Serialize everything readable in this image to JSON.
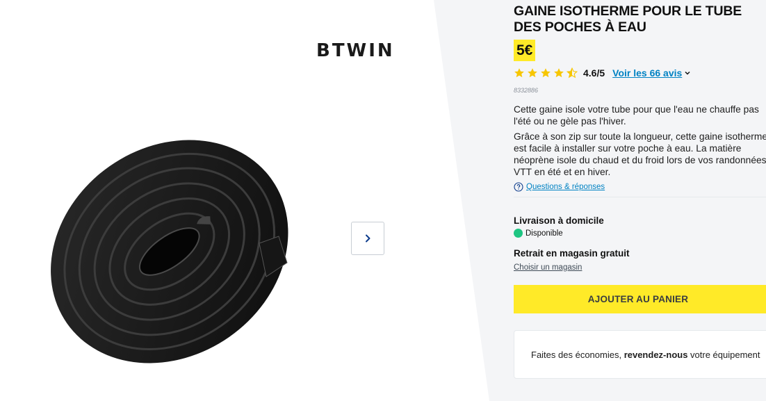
{
  "brand": {
    "logo_text": "BTWIN"
  },
  "gallery": {
    "next_button_icon": "chevron-right-icon"
  },
  "product": {
    "title": "GAINE ISOTHERME POUR LE TUBE DES POCHES À EAU",
    "price": "5€",
    "rating": {
      "stars": 4.6,
      "value_text": "4.6/5",
      "reviews_link": "Voir les 66 avis"
    },
    "reference": "8332886",
    "description": [
      "Cette gaine isole votre tube pour que l'eau ne chauffe pas l'été ou ne gèle pas l'hiver.",
      "Grâce à son zip sur toute la longueur, cette gaine isotherme est facile à installer sur votre poche à eau. La matière néoprène isole du chaud et du froid lors de vos randonnées VTT en été et en hiver."
    ],
    "qa_link": "Questions & réponses"
  },
  "delivery": {
    "title": "Livraison à domicile",
    "status": "Disponible",
    "status_color": "#1ec582"
  },
  "pickup": {
    "title": "Retrait en magasin gratuit",
    "link": "Choisir un magasin"
  },
  "cart": {
    "button_label": "AJOUTER AU PANIER"
  },
  "resale": {
    "text_before": "Faites des économies, ",
    "text_bold": "revendez-nous",
    "text_after": " votre équipement"
  },
  "colors": {
    "accent_yellow": "#ffea28",
    "link_blue": "#0082c3",
    "panel_bg": "#f4f5f7"
  }
}
